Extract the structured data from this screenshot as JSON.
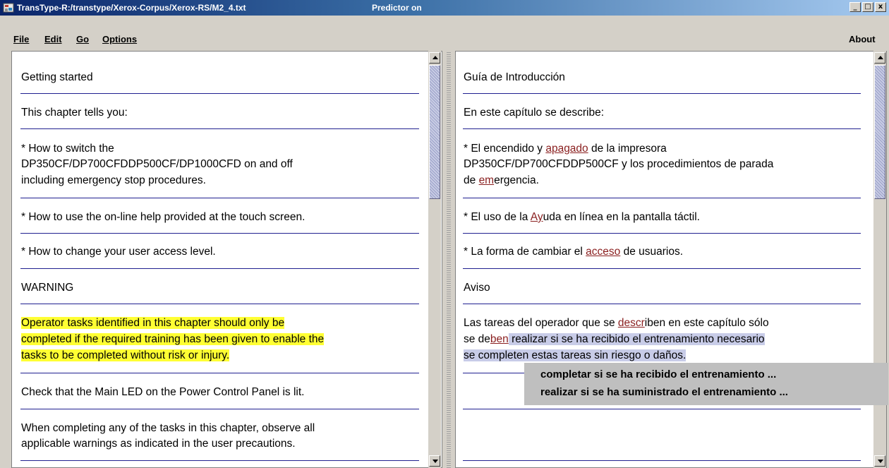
{
  "window": {
    "title": "TransType-R:/transtype/Xerox-Corpus/Xerox-RS/M2_4.txt",
    "predictor_status": "Predictor on",
    "buttons": {
      "minimize": "_",
      "maximize": "□",
      "close": "x"
    }
  },
  "menubar": {
    "file_label": "File",
    "edit_label": "Edit",
    "go_label": "Go",
    "options_label": "Options",
    "about_label": "About"
  },
  "source": [
    "Getting started",
    "This chapter tells you:",
    "* How to switch the",
    "DP350CF/DP700CFDDP500CF/DP1000CFD on and off",
    "including emergency stop procedures.",
    "* How to use the on-line help provided at the touch screen.",
    "* How to change your user access level.",
    "WARNING",
    "Operator tasks identified in this chapter should only be",
    "completed if the required training has been given to enable the",
    "tasks to be completed without risk or injury.",
    "Check that the Main LED on the Power Control Panel is lit.",
    "When completing any of the tasks in this chapter, observe all",
    "applicable warnings as indicated in the user precautions."
  ],
  "target": {
    "s1": "Guía de Introducción",
    "s2": "En este capítulo se describe:",
    "s3_a": "* El encendido y ",
    "s3_mark": "apagado",
    "s3_b": " de la impresora",
    "s3_line2": "DP350CF/DP700CFDDP500CF y los procedimientos de parada",
    "s3_line3a": "de ",
    "s3_line3mark": "em",
    "s3_line3b": "ergencia.",
    "s4_a": "* El uso de la ",
    "s4_mark": "Ay",
    "s4_b": "uda en línea en la pantalla táctil.",
    "s5_a": "* La forma de cambiar el ",
    "s5_mark": "acceso",
    "s5_b": " de usuarios.",
    "s6": "Aviso",
    "s7_a": "Las tareas del operador que se ",
    "s7_mark": "descr",
    "s7_b": "iben en este capítulo sólo",
    "s7_line2a": "se de",
    "s7_line2mark": "ben",
    "s7_line2hl": " realizar si se ha recibido el entrenamiento necesario",
    "s7_line3hl": "se completen estas tareas sin riesgo o daños."
  },
  "suggestions": [
    "completar si se ha recibido el entrenamiento ...",
    "realizar si se ha suministrado el entrenamiento ..."
  ],
  "colors": {
    "highlight_yellow": "#ffff33",
    "highlight_blue": "#c8cce8",
    "rule": "#202090",
    "mark": "#8a1f1f"
  }
}
